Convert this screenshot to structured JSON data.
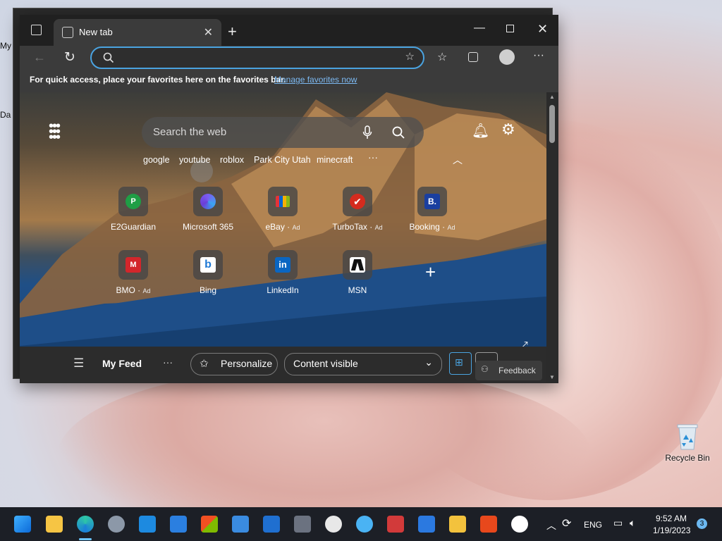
{
  "desktop": {
    "left_label_1": "My",
    "left_label_2": "Da",
    "recycle_bin_label": "Recycle Bin"
  },
  "browser": {
    "tab_label": "New tab",
    "address_value": "",
    "favbar_text": "For quick access, place your favorites here on the favorites bar.",
    "favbar_link": "Manage favorites now"
  },
  "newtab": {
    "search_placeholder": "Search the web",
    "quick_links": [
      "google",
      "youtube",
      "roblox",
      "Park City Utah",
      "minecraft"
    ],
    "quick_more": "···",
    "tiles": [
      {
        "label": "E2Guardian",
        "ad": "",
        "glyph": "P",
        "color": "#1f9e45"
      },
      {
        "label": "Microsoft 365",
        "ad": "",
        "glyph": "",
        "color": "#5b6cf0"
      },
      {
        "label": "eBay",
        "ad": "Ad",
        "glyph": "",
        "color": "#e53238"
      },
      {
        "label": "TurboTax",
        "ad": "Ad",
        "glyph": "✔",
        "color": "#d52b1e"
      },
      {
        "label": "Booking",
        "ad": "Ad",
        "glyph": "B.",
        "color": "#1a3fa0"
      },
      {
        "label": "BMO",
        "ad": "Ad",
        "glyph": "M",
        "color": "#d3262b"
      },
      {
        "label": "Bing",
        "ad": "",
        "glyph": "b",
        "color": "#1e78d4"
      },
      {
        "label": "LinkedIn",
        "ad": "",
        "glyph": "in",
        "color": "#0a66c2"
      },
      {
        "label": "MSN",
        "ad": "",
        "glyph": "",
        "color": "#111111"
      }
    ],
    "feed_title": "My Feed",
    "feed_more": "···",
    "personalize_label": "Personalize",
    "content_select": "Content visible",
    "feedback_label": "Feedback"
  },
  "taskbar": {
    "lang": "ENG",
    "time": "9:52 AM",
    "date": "1/19/2023",
    "notifications": "3"
  },
  "colors": {
    "accent": "#4aa3e0",
    "link": "#7cb9f2"
  }
}
